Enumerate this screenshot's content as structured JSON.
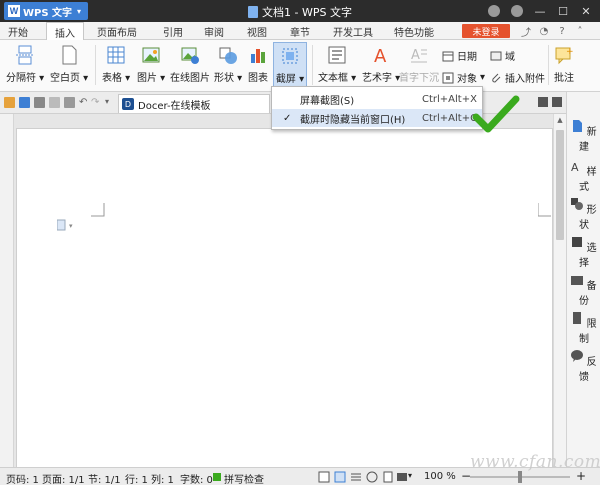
{
  "titlebar": {
    "app_name": "WPS 文字",
    "caret": "▾",
    "doc_title": "文档1 - WPS 文字"
  },
  "tabs": [
    "开始",
    "插入",
    "页面布局",
    "引用",
    "审阅",
    "视图",
    "章节",
    "开发工具",
    "特色功能"
  ],
  "active_tab": "插入",
  "login_label": "未登录",
  "ribbon": {
    "page_break": "分隔符",
    "blank_page": "空白页",
    "table": "表格",
    "picture": "图片",
    "online_picture": "在线图片",
    "shape": "形状",
    "chart": "图表",
    "screenshot": "截屏",
    "textbox": "文本框",
    "wordart": "艺术字",
    "dropcap": "首字下沉",
    "date": "日期",
    "field": "域",
    "object": "对象",
    "attachment": "插入附件",
    "comment": "批注"
  },
  "doc_tab": {
    "label": "Docer-在线模板",
    "icon_text": "D"
  },
  "dropdown": {
    "items": [
      {
        "label": "屏幕截图(S)",
        "shortcut": "Ctrl+Alt+X"
      },
      {
        "label": "截屏时隐藏当前窗口(H)",
        "shortcut": "Ctrl+Alt+C",
        "checked": "✓"
      }
    ]
  },
  "right_panel": [
    "新建",
    "样式",
    "形状",
    "选择",
    "备份",
    "限制",
    "反馈"
  ],
  "status": {
    "page_no": "页码: 1",
    "page": "页面: 1/1",
    "section": "节: 1/1",
    "row": "行: 1",
    "col": "列: 1",
    "words": "字数: 0",
    "spell": "拼写检查",
    "zoom": "100 %",
    "minus": "−",
    "plus": "+"
  },
  "watermark": "www.cfan.com.cn",
  "colors": {
    "titlebar": "#2c2c2c",
    "app_button": "#3d7fd4",
    "login": "#e5522d",
    "highlight": "#dbe7f7",
    "check_green": "#3aaa1e"
  }
}
